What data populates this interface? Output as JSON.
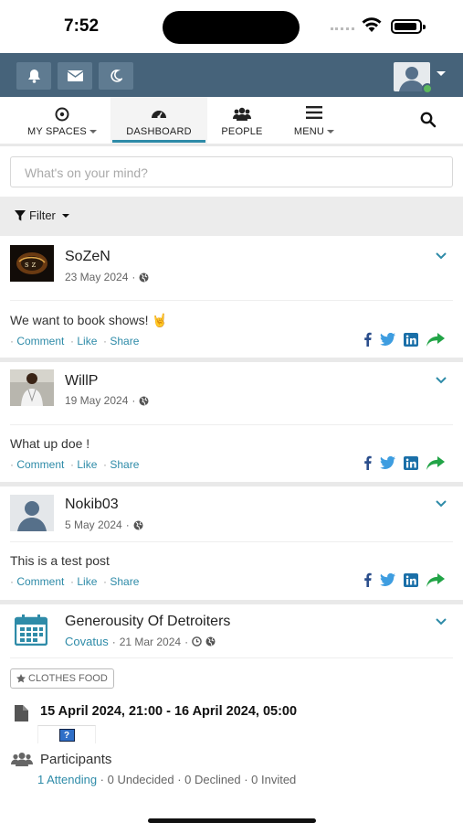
{
  "status_bar": {
    "time": "7:52"
  },
  "nav": {
    "items": [
      {
        "label": "MY SPACES"
      },
      {
        "label": "DASHBOARD"
      },
      {
        "label": "PEOPLE"
      },
      {
        "label": "MENU"
      }
    ]
  },
  "composer": {
    "placeholder": "What's on your mind?"
  },
  "filter": {
    "label": "Filter"
  },
  "actions": {
    "comment": "Comment",
    "like": "Like",
    "share": "Share"
  },
  "posts": [
    {
      "author": "SoZeN",
      "date": "23 May 2024",
      "text": "We want to book shows!",
      "emoji": "🤘"
    },
    {
      "author": "WillP",
      "date": "19 May 2024",
      "text": "What up doe !"
    },
    {
      "author": "Nokib03",
      "date": "5 May 2024",
      "text": "This is a test post"
    }
  ],
  "event": {
    "title": "Generousity Of Detroiters",
    "space": "Covatus",
    "date": "21 Mar 2024",
    "tag": "CLOTHES FOOD",
    "when": "15 April 2024, 21:00 - 16 April 2024, 05:00",
    "participants_label": "Participants",
    "attending": "1 Attending",
    "rest": " · 0 Undecided · 0 Declined · 0 Invited"
  },
  "colors": {
    "header": "#46637a",
    "accent": "#2e8ba8",
    "online": "#5cb85c",
    "share": "#22a447"
  }
}
